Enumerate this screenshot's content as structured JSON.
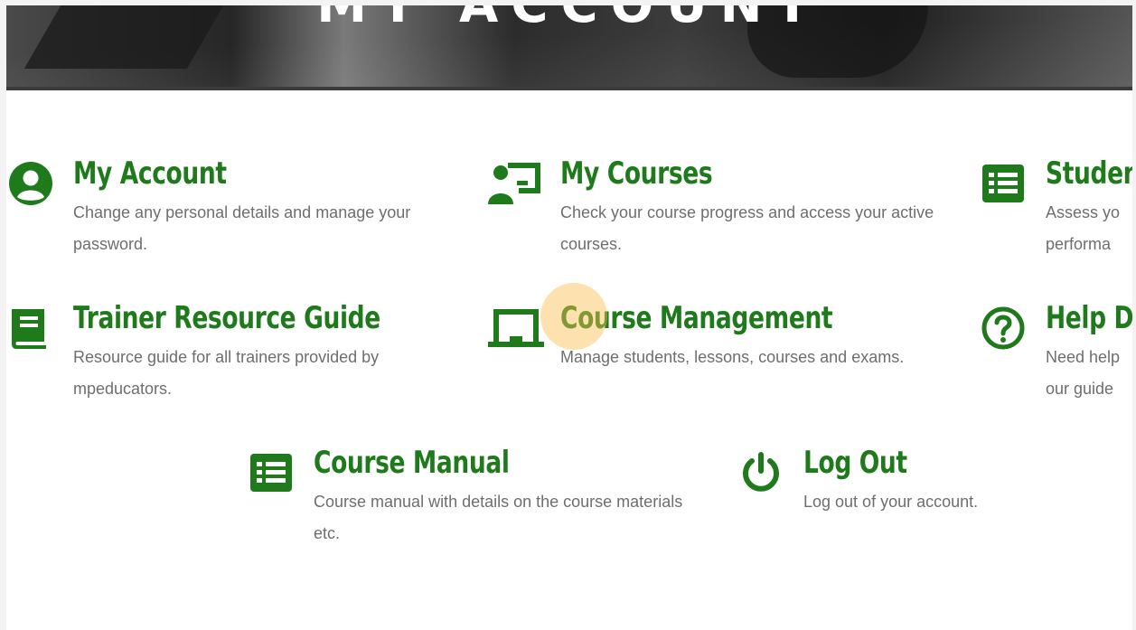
{
  "hero": {
    "title": "MY ACCOUNT"
  },
  "cards": [
    {
      "title": "My Account",
      "desc": "Change any personal details and manage your password.",
      "icon": "user-circle-icon"
    },
    {
      "title": "My Courses",
      "desc": "Check your course progress and access your active courses.",
      "icon": "chalkboard-teacher-icon"
    },
    {
      "title": "Studen",
      "desc": "Assess yo performa",
      "icon": "list-icon"
    },
    {
      "title": "Trainer Resource Guide",
      "desc": "Resource guide for all trainers provided by mpeducators.",
      "icon": "book-icon"
    },
    {
      "title": "Course Management",
      "desc": "Manage students, lessons, courses and exams.",
      "icon": "laptop-icon"
    },
    {
      "title": "Help De",
      "desc": "Need help our guide",
      "icon": "question-circle-icon"
    },
    {
      "title": "Course Manual",
      "desc": "Course manual with details on the course materials etc.",
      "icon": "list-icon"
    },
    {
      "title": "Log Out",
      "desc": "Log out of your account.",
      "icon": "power-icon"
    }
  ],
  "colors": {
    "accent": "#1f7a1c",
    "text": "#6e6e6e"
  }
}
